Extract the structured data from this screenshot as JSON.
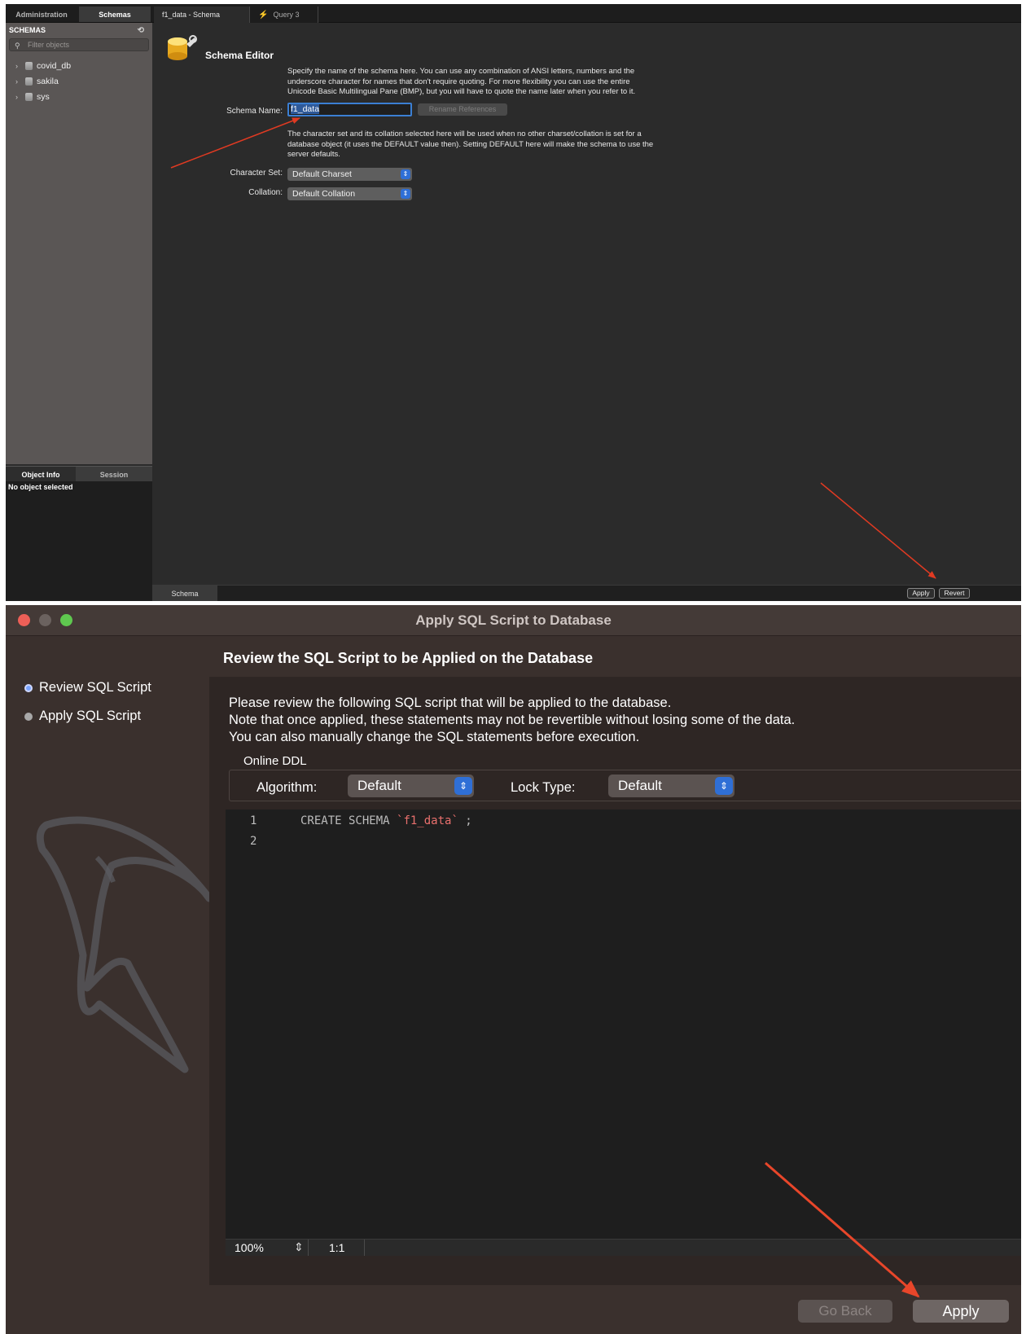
{
  "workbench": {
    "sidebar_tabs": [
      "Administration",
      "Schemas"
    ],
    "doc_tabs": [
      "f1_data - Schema",
      "Query 3"
    ],
    "schemas_heading": "SCHEMAS",
    "filter_placeholder": "Filter objects",
    "schemas": [
      "covid_db",
      "sakila",
      "sys"
    ],
    "info_tabs": [
      "Object Info",
      "Session"
    ],
    "info_text": "No object selected",
    "editor_title": "Schema Editor",
    "name_help": "Specify the name of the schema here. You can use any combination of ANSI letters, numbers and the\nunderscore character for names that don't require quoting. For more flexibility you can use the entire\nUnicode Basic Multilingual Pane (BMP), but you will have to quote the name later when you refer to it.",
    "schema_name_label": "Schema Name:",
    "schema_name_value": "f1_data",
    "rename_references": "Rename References",
    "charset_help": "The character set and its collation selected here will be used when no other charset/collation is set for a\ndatabase object (it uses the DEFAULT value then). Setting DEFAULT here will make the schema to use the\nserver defaults.",
    "charset_label": "Character Set:",
    "charset_value": "Default Charset",
    "collation_label": "Collation:",
    "collation_value": "Default Collation",
    "bottom_tab": "Schema",
    "apply": "Apply",
    "revert": "Revert"
  },
  "dialog": {
    "title": "Apply SQL Script to Database",
    "heading": "Review the SQL Script to be Applied on the Database",
    "steps": [
      "Review SQL Script",
      "Apply SQL Script"
    ],
    "description": "Please review the following SQL script that will be applied to the database.\nNote that once applied, these statements may not be revertible without losing some of the data.\nYou can also manually change the SQL statements before execution.",
    "online_ddl": "Online DDL",
    "algorithm_label": "Algorithm:",
    "algorithm_value": "Default",
    "lock_type_label": "Lock Type:",
    "lock_type_value": "Default",
    "line_numbers": [
      "1",
      "2"
    ],
    "sql_keyword": "CREATE SCHEMA ",
    "sql_identifier": "`f1_data`",
    "sql_end": " ;",
    "zoom": "100%",
    "cursor_position": "1:1",
    "go_back": "Go Back",
    "apply": "Apply"
  },
  "colors": {
    "annotation_arrow": "#e03a22",
    "accent_blue": "#2f6fd6",
    "sql_identifier": "#e9706d"
  }
}
